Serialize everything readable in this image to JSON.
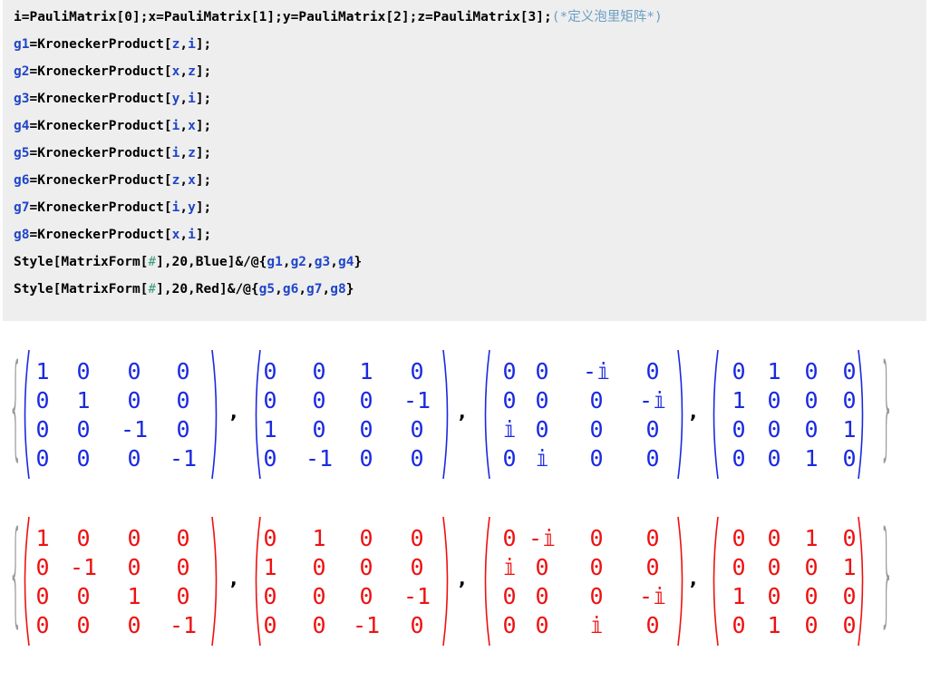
{
  "code_lines": [
    [
      [
        "i",
        "s"
      ],
      [
        "=PauliMatrix[",
        "s"
      ],
      [
        "0",
        "s"
      ],
      [
        "];",
        "s"
      ],
      [
        "x",
        "s"
      ],
      [
        "=PauliMatrix[",
        "s"
      ],
      [
        "1",
        "s"
      ],
      [
        "];",
        "s"
      ],
      [
        "y",
        "s"
      ],
      [
        "=PauliMatrix[",
        "s"
      ],
      [
        "2",
        "s"
      ],
      [
        "];",
        "s"
      ],
      [
        "z",
        "s"
      ],
      [
        "=PauliMatrix[",
        "s"
      ],
      [
        "3",
        "s"
      ],
      [
        "];",
        "s"
      ],
      [
        "(*定义泡里矩阵*)",
        "c"
      ]
    ],
    [
      [
        "g1",
        "v"
      ],
      [
        "=KroneckerProduct[",
        "s"
      ],
      [
        "z",
        "v"
      ],
      [
        ",",
        "s"
      ],
      [
        "i",
        "v"
      ],
      [
        "];",
        "s"
      ]
    ],
    [
      [
        "g2",
        "v"
      ],
      [
        "=KroneckerProduct[",
        "s"
      ],
      [
        "x",
        "v"
      ],
      [
        ",",
        "s"
      ],
      [
        "z",
        "v"
      ],
      [
        "];",
        "s"
      ]
    ],
    [
      [
        "g3",
        "v"
      ],
      [
        "=KroneckerProduct[",
        "s"
      ],
      [
        "y",
        "v"
      ],
      [
        ",",
        "s"
      ],
      [
        "i",
        "v"
      ],
      [
        "];",
        "s"
      ]
    ],
    [
      [
        "g4",
        "v"
      ],
      [
        "=KroneckerProduct[",
        "s"
      ],
      [
        "i",
        "v"
      ],
      [
        ",",
        "s"
      ],
      [
        "x",
        "v"
      ],
      [
        "];",
        "s"
      ]
    ],
    [
      [
        "g5",
        "v"
      ],
      [
        "=KroneckerProduct[",
        "s"
      ],
      [
        "i",
        "v"
      ],
      [
        ",",
        "s"
      ],
      [
        "z",
        "v"
      ],
      [
        "];",
        "s"
      ]
    ],
    [
      [
        "g6",
        "v"
      ],
      [
        "=KroneckerProduct[",
        "s"
      ],
      [
        "z",
        "v"
      ],
      [
        ",",
        "s"
      ],
      [
        "x",
        "v"
      ],
      [
        "];",
        "s"
      ]
    ],
    [
      [
        "g7",
        "v"
      ],
      [
        "=KroneckerProduct[",
        "s"
      ],
      [
        "i",
        "v"
      ],
      [
        ",",
        "s"
      ],
      [
        "y",
        "v"
      ],
      [
        "];",
        "s"
      ]
    ],
    [
      [
        "g8",
        "v"
      ],
      [
        "=KroneckerProduct[",
        "s"
      ],
      [
        "x",
        "v"
      ],
      [
        ",",
        "s"
      ],
      [
        "i",
        "v"
      ],
      [
        "];",
        "s"
      ]
    ],
    [
      [
        "Style[MatrixForm[",
        "s"
      ],
      [
        "#",
        "slot"
      ],
      [
        "],20,Blue]&/@{",
        "s"
      ],
      [
        "g1",
        "v"
      ],
      [
        ",",
        "s"
      ],
      [
        "g2",
        "v"
      ],
      [
        ",",
        "s"
      ],
      [
        "g3",
        "v"
      ],
      [
        ",",
        "s"
      ],
      [
        "g4",
        "v"
      ],
      [
        "}",
        "s"
      ]
    ],
    [
      [
        "Style[MatrixForm[",
        "s"
      ],
      [
        "#",
        "slot"
      ],
      [
        "],20,Red]&/@{",
        "s"
      ],
      [
        "g5",
        "v"
      ],
      [
        ",",
        "s"
      ],
      [
        "g6",
        "v"
      ],
      [
        ",",
        "s"
      ],
      [
        "g7",
        "v"
      ],
      [
        ",",
        "s"
      ],
      [
        "g8",
        "v"
      ],
      [
        "}",
        "s"
      ]
    ]
  ],
  "outputs": [
    {
      "color": "#1a2ae0",
      "open_brace": "{",
      "close_brace": "}",
      "separator": ",",
      "matrices": [
        [
          [
            "1",
            "0",
            "0",
            "0"
          ],
          [
            "0",
            "1",
            "0",
            "0"
          ],
          [
            "0",
            "0",
            "-1",
            "0"
          ],
          [
            "0",
            "0",
            "0",
            "-1"
          ]
        ],
        [
          [
            "0",
            "0",
            "1",
            "0"
          ],
          [
            "0",
            "0",
            "0",
            "-1"
          ],
          [
            "1",
            "0",
            "0",
            "0"
          ],
          [
            "0",
            "-1",
            "0",
            "0"
          ]
        ],
        [
          [
            "0",
            "0",
            "-𝕚",
            "0"
          ],
          [
            "0",
            "0",
            "0",
            "-𝕚"
          ],
          [
            "𝕚",
            "0",
            "0",
            "0"
          ],
          [
            "0",
            "𝕚",
            "0",
            "0"
          ]
        ],
        [
          [
            "0",
            "1",
            "0",
            "0"
          ],
          [
            "1",
            "0",
            "0",
            "0"
          ],
          [
            "0",
            "0",
            "0",
            "1"
          ],
          [
            "0",
            "0",
            "1",
            "0"
          ]
        ]
      ]
    },
    {
      "color": "#ee1111",
      "open_brace": "{",
      "close_brace": "}",
      "separator": ",",
      "matrices": [
        [
          [
            "1",
            "0",
            "0",
            "0"
          ],
          [
            "0",
            "-1",
            "0",
            "0"
          ],
          [
            "0",
            "0",
            "1",
            "0"
          ],
          [
            "0",
            "0",
            "0",
            "-1"
          ]
        ],
        [
          [
            "0",
            "1",
            "0",
            "0"
          ],
          [
            "1",
            "0",
            "0",
            "0"
          ],
          [
            "0",
            "0",
            "0",
            "-1"
          ],
          [
            "0",
            "0",
            "-1",
            "0"
          ]
        ],
        [
          [
            "0",
            "-𝕚",
            "0",
            "0"
          ],
          [
            "𝕚",
            "0",
            "0",
            "0"
          ],
          [
            "0",
            "0",
            "0",
            "-𝕚"
          ],
          [
            "0",
            "0",
            "𝕚",
            "0"
          ]
        ],
        [
          [
            "0",
            "0",
            "1",
            "0"
          ],
          [
            "0",
            "0",
            "0",
            "1"
          ],
          [
            "1",
            "0",
            "0",
            "0"
          ],
          [
            "0",
            "1",
            "0",
            "0"
          ]
        ]
      ]
    }
  ]
}
